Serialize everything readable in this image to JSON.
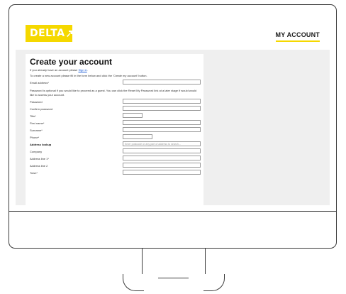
{
  "header": {
    "logo_text": "DELTA",
    "logo_color": "#f5d800",
    "account_link": "MY ACCOUNT"
  },
  "form": {
    "title": "Create your account",
    "intro_prefix": "If you already have an account please ",
    "sign_in_link": "Sign in",
    "intro_suffix": ".",
    "instructions": "To create a new account please fill in the form below and click the 'Create my account' button.",
    "password_note": "Password is optional if you would like to proceed as a guest. You can click the Reset My Password link at a later stage if would would like to access your account.",
    "fields": {
      "email": "Email address*",
      "password": "Password",
      "confirm_password": "Confirm password",
      "title": "Title*",
      "first_name": "First name*",
      "surname": "Surname*",
      "phone": "Phone*",
      "address_lookup": "Address lookup",
      "address_lookup_placeholder": "Enter postcode or any part of address to search...",
      "company": "Company",
      "address1": "Address line 1*",
      "address2": "Address line 2",
      "town": "Town*"
    }
  }
}
